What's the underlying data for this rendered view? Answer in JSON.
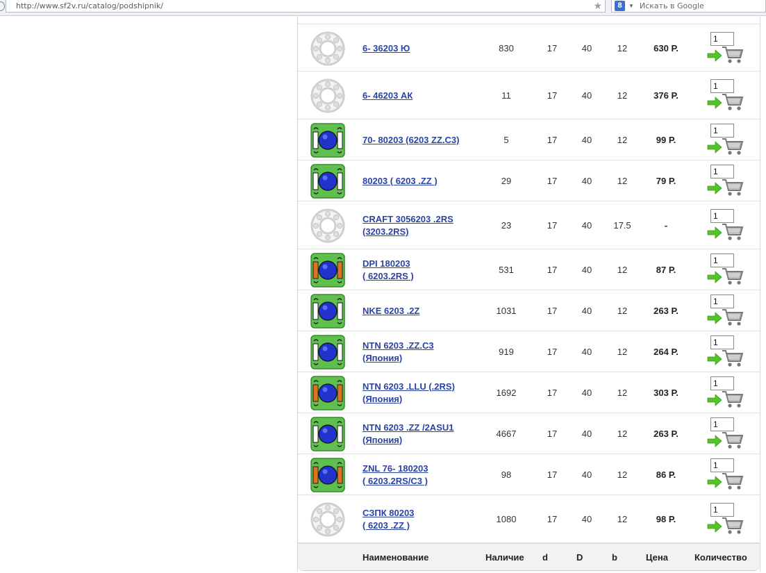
{
  "browser": {
    "url": "http://www.sf2v.ru/catalog/podshipnik/",
    "search_placeholder": "Искать в Google",
    "search_engine_letter": "8"
  },
  "columns": {
    "name": "Наименование",
    "stock": "Наличие",
    "d": "d",
    "D": "D",
    "b": "b",
    "price": "Цена",
    "qty": "Количество"
  },
  "rows": [
    {
      "line1": "6- 36203 Ю",
      "line2": "",
      "stock": "830",
      "d": "17",
      "D": "40",
      "b": "12",
      "price": "630 Р.",
      "qty": "1",
      "icon": "gray-ring-bearing-icon"
    },
    {
      "line1": "6- 46203 АК",
      "line2": "",
      "stock": "11",
      "d": "17",
      "D": "40",
      "b": "12",
      "price": "376 Р.",
      "qty": "1",
      "icon": "gray-ring-bearing-icon"
    },
    {
      "line1": "70- 80203 (6203 ZZ.C3)",
      "line2": "",
      "stock": "5",
      "d": "17",
      "D": "40",
      "b": "12",
      "price": "99 Р.",
      "qty": "1",
      "icon": "shielded-bearing-icon"
    },
    {
      "line1": "80203 ( 6203 .ZZ )",
      "line2": "",
      "stock": "29",
      "d": "17",
      "D": "40",
      "b": "12",
      "price": "79 Р.",
      "qty": "1",
      "icon": "shielded-bearing-icon"
    },
    {
      "line1": "CRAFT 3056203 .2RS",
      "line2": "(3203.2RS)",
      "stock": "23",
      "d": "17",
      "D": "40",
      "b": "17.5",
      "price": "-",
      "qty": "1",
      "icon": "gray-ring-bearing-icon"
    },
    {
      "line1": "DPI 180203",
      "line2": "( 6203.2RS )",
      "stock": "531",
      "d": "17",
      "D": "40",
      "b": "12",
      "price": "87 Р.",
      "qty": "1",
      "icon": "sealed-bearing-icon"
    },
    {
      "line1": "NKE 6203 .2Z",
      "line2": "",
      "stock": "1031",
      "d": "17",
      "D": "40",
      "b": "12",
      "price": "263 Р.",
      "qty": "1",
      "icon": "shielded-bearing-icon"
    },
    {
      "line1": "NTN 6203 .ZZ.C3",
      "line2": "(Япония)",
      "stock": "919",
      "d": "17",
      "D": "40",
      "b": "12",
      "price": "264 Р.",
      "qty": "1",
      "icon": "shielded-bearing-icon"
    },
    {
      "line1": "NTN 6203 .LLU (.2RS)",
      "line2": "(Япония)",
      "stock": "1692",
      "d": "17",
      "D": "40",
      "b": "12",
      "price": "303 Р.",
      "qty": "1",
      "icon": "sealed-bearing-icon"
    },
    {
      "line1": "NTN 6203 .ZZ /2ASU1",
      "line2": "(Япония)",
      "stock": "4667",
      "d": "17",
      "D": "40",
      "b": "12",
      "price": "263 Р.",
      "qty": "1",
      "icon": "shielded-bearing-icon"
    },
    {
      "line1": "ZNL 76- 180203",
      "line2": "( 6203.2RS/C3 )",
      "stock": "98",
      "d": "17",
      "D": "40",
      "b": "12",
      "price": "86 Р.",
      "qty": "1",
      "icon": "sealed-bearing-icon"
    },
    {
      "line1": "СЗПК 80203",
      "line2": "( 6203 .ZZ )",
      "stock": "1080",
      "d": "17",
      "D": "40",
      "b": "12",
      "price": "98 Р.",
      "qty": "1",
      "icon": "gray-ring-bearing-icon"
    }
  ],
  "colors": {
    "link": "#2a43a8",
    "bearing_green": "#5fbf4f",
    "bearing_ball": "#2233cc",
    "seal_orange": "#e0731e",
    "cart_arrow": "#55c22a"
  }
}
